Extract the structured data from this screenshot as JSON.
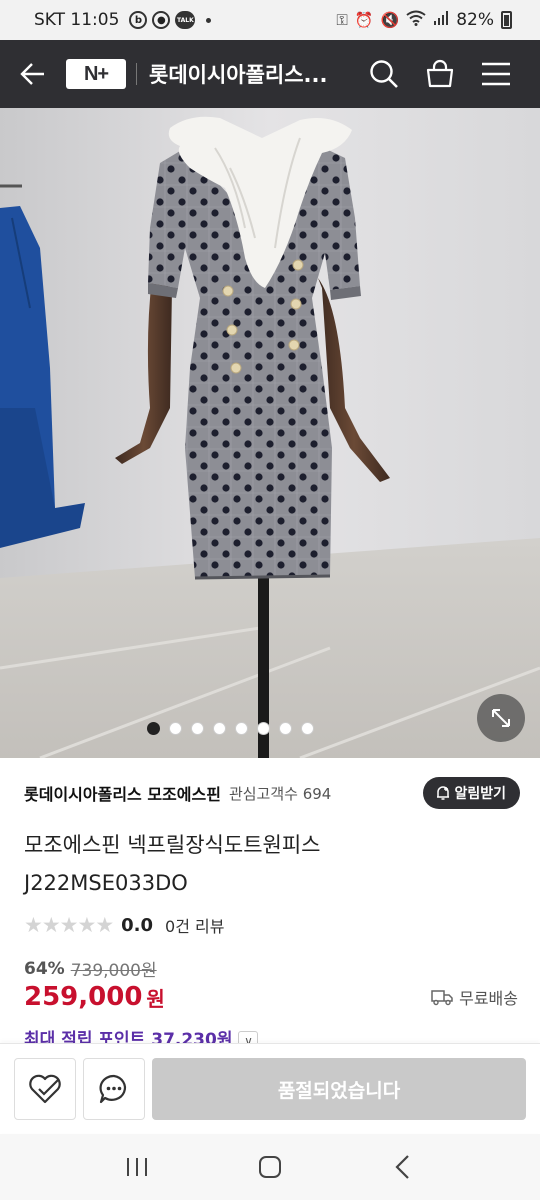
{
  "status_bar": {
    "carrier_time": "SKT 11:05",
    "talk_label": "TALK",
    "battery": "82%"
  },
  "header": {
    "logo": "N+",
    "title": "롯데이시아폴리스...",
    "icons": [
      "back-arrow-icon",
      "search-icon",
      "cart-icon",
      "menu-icon"
    ]
  },
  "gallery": {
    "image_count": 8,
    "active_index": 0
  },
  "seller": {
    "name": "롯데이시아폴리스 모조에스핀",
    "interest_label": "관심고객수 694",
    "notify_label": "알림받기"
  },
  "product": {
    "title_line1": "모조에스핀 넥프릴장식도트원피스",
    "title_line2": "J222MSE033DO",
    "rating": "0.0",
    "review_count": "0건 리뷰",
    "stars_filled": 0,
    "discount_rate": "64%",
    "original_price": "739,000원",
    "sale_price": "259,000",
    "price_unit": "원",
    "shipping": "무료배송",
    "points": "최대 적립 포인트 37,230원"
  },
  "bottom_bar": {
    "soldout_label": "품절되었습니다"
  },
  "colors": {
    "header_bg": "#2f2f33",
    "price_red": "#c8102e",
    "points_purple": "#5b2fa8",
    "soldout_gray": "#c9c9c9"
  }
}
